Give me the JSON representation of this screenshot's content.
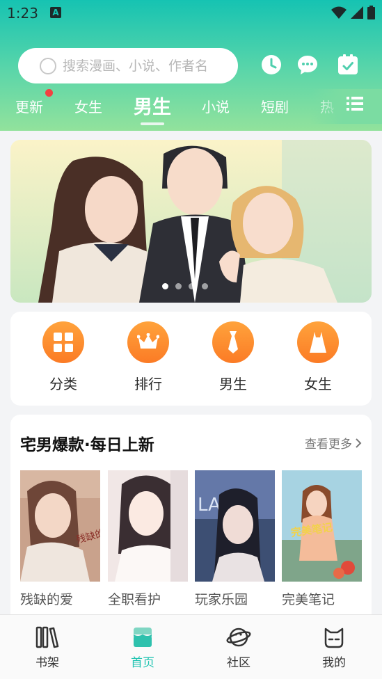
{
  "status_bar": {
    "time": "1:23",
    "notification_badge": "A"
  },
  "search": {
    "placeholder": "搜索漫画、小说、作者名"
  },
  "tabs": [
    {
      "label": "更新",
      "has_dot": true
    },
    {
      "label": "女生"
    },
    {
      "label": "男生",
      "active": true
    },
    {
      "label": "小说"
    },
    {
      "label": "短剧"
    },
    {
      "label": "热"
    }
  ],
  "banner": {
    "page_count": 4,
    "active_page": 1
  },
  "quick_nav": [
    {
      "label": "分类",
      "icon": "grid-icon"
    },
    {
      "label": "排行",
      "icon": "crown-icon"
    },
    {
      "label": "男生",
      "icon": "tie-icon"
    },
    {
      "label": "女生",
      "icon": "dress-icon"
    }
  ],
  "section": {
    "title": "宅男爆款·每日上新",
    "more_label": "查看更多",
    "books": [
      {
        "title": "残缺的爱",
        "cover_text": "残缺的爱"
      },
      {
        "title": "全职看护"
      },
      {
        "title": "玩家乐园",
        "cover_text": "LA"
      },
      {
        "title": "完美笔记",
        "cover_text": "完美笔记"
      }
    ]
  },
  "bottom_nav": [
    {
      "label": "书架",
      "icon": "bookshelf-icon"
    },
    {
      "label": "首页",
      "icon": "home-icon",
      "active": true
    },
    {
      "label": "社区",
      "icon": "planet-icon"
    },
    {
      "label": "我的",
      "icon": "cat-face-icon"
    }
  ],
  "colors": {
    "accent": "#1ec3b0",
    "orange": "#fb7b25",
    "dot": "#f24141"
  }
}
